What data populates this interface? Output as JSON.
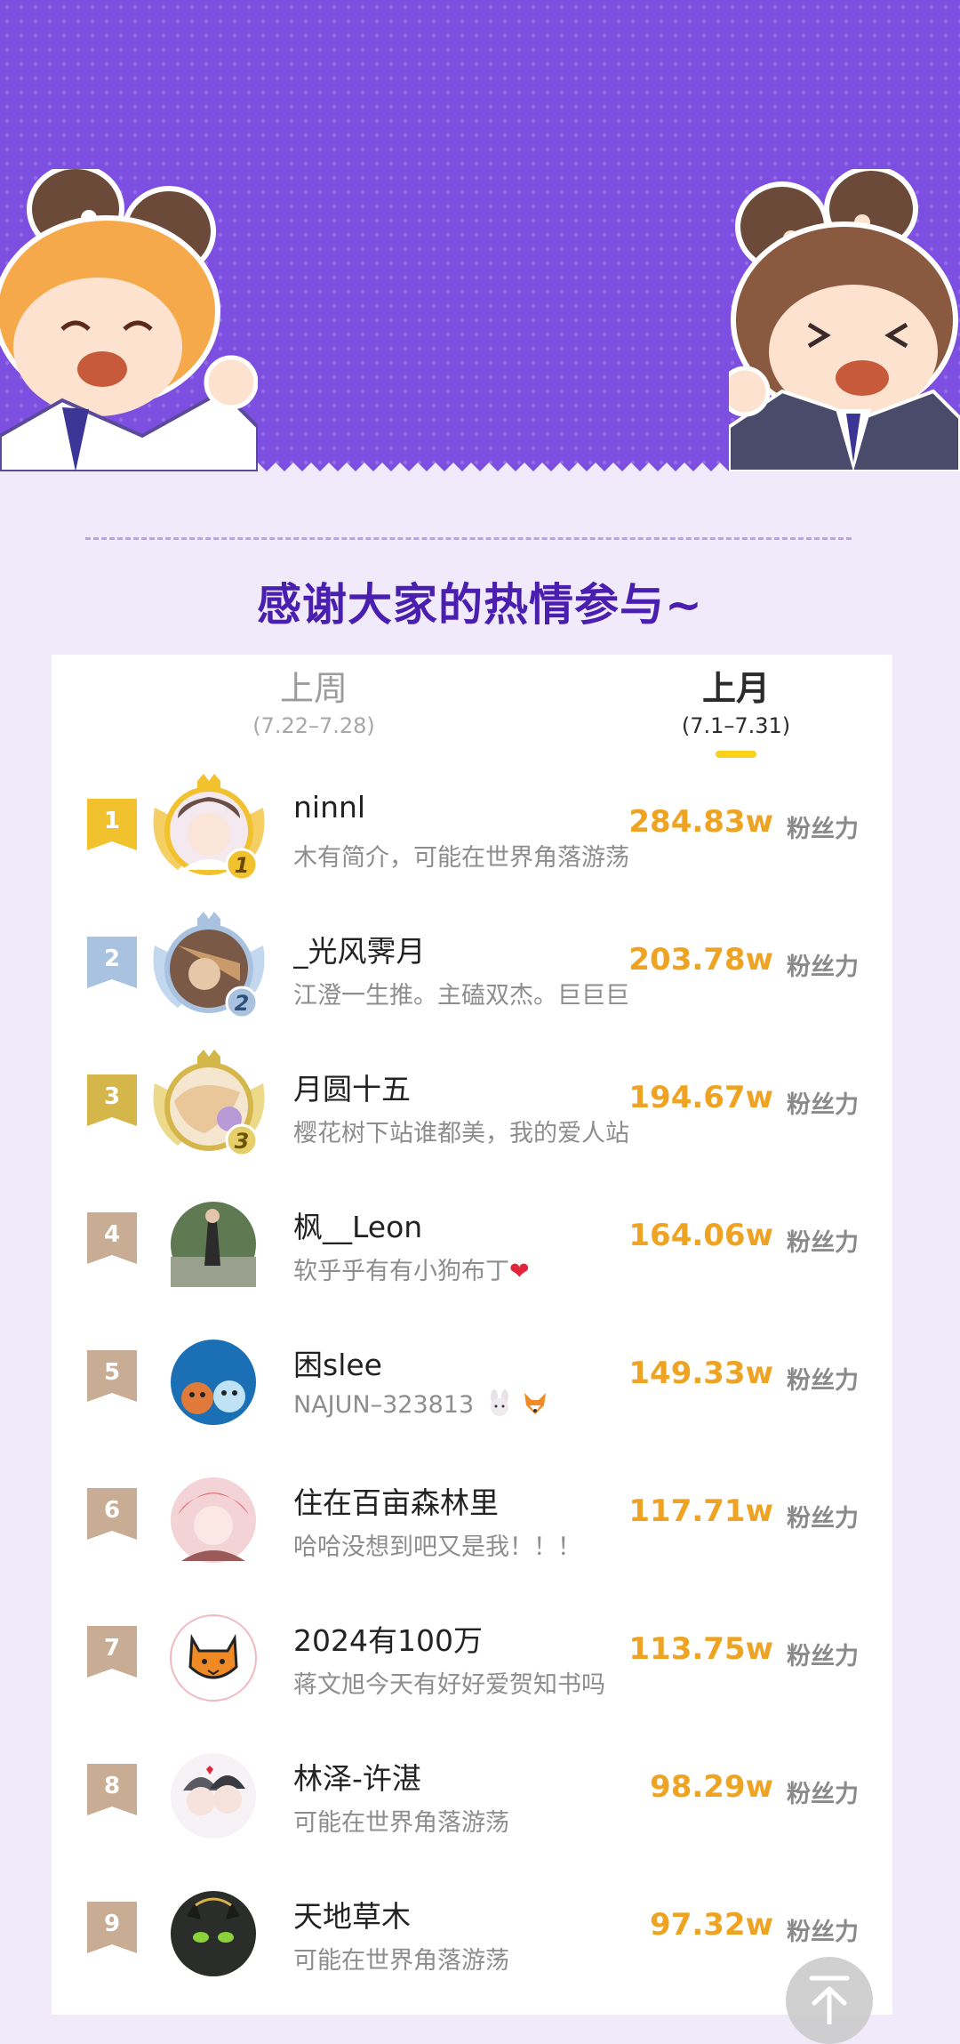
{
  "header": {
    "thanks_title": "感谢大家的热情参与~"
  },
  "tabs": [
    {
      "label": "上周",
      "range": "(7.22–7.28)",
      "active": false
    },
    {
      "label": "上月",
      "range": "(7.1–7.31)",
      "active": true
    }
  ],
  "fan_unit": "粉丝力",
  "leaderboard": [
    {
      "rank": "1",
      "name": "ninnl",
      "bio": "木有简介，可能在世界角落游荡",
      "fans": "284.83w",
      "badge": "1"
    },
    {
      "rank": "2",
      "name": "_光风霁月",
      "bio": "江澄一生推。主磕双杰。巨巨巨",
      "fans": "203.78w",
      "badge": "2"
    },
    {
      "rank": "3",
      "name": "月圆十五",
      "bio": "樱花树下站谁都美，我的爱人站",
      "fans": "194.67w",
      "badge": "3"
    },
    {
      "rank": "4",
      "name": "枫__Leon",
      "bio": "软乎乎有有小狗布丁",
      "fans": "164.06w"
    },
    {
      "rank": "5",
      "name": "困slee",
      "bio": "NAJUN–323813",
      "fans": "149.33w"
    },
    {
      "rank": "6",
      "name": "住在百亩森林里",
      "bio": "哈哈没想到吧又是我！！！",
      "fans": "117.71w"
    },
    {
      "rank": "7",
      "name": "2024有100万",
      "bio": "蒋文旭今天有好好爱贺知书吗",
      "fans": "113.75w"
    },
    {
      "rank": "8",
      "name": "林泽-许湛",
      "bio": "可能在世界角落游荡",
      "fans": "98.29w"
    },
    {
      "rank": "9",
      "name": "天地草木",
      "bio": "可能在世界角落游荡",
      "fans": "97.32w"
    }
  ],
  "colors": {
    "banner": "#7d4fe0",
    "title": "#4a1fb0",
    "fan_value": "#eea322",
    "tab_underline": "#f7d11c",
    "rank_gold": "#f2c12e",
    "rank_silver": "#a9c2e0",
    "rank_bronze": "#d4b64a",
    "rank_default": "#c8ad94"
  },
  "icons": {
    "back_top": "arrow-up-icon",
    "heart": "red-heart-emoji",
    "bunny": "bunny-emoji",
    "fox": "fox-emoji"
  }
}
